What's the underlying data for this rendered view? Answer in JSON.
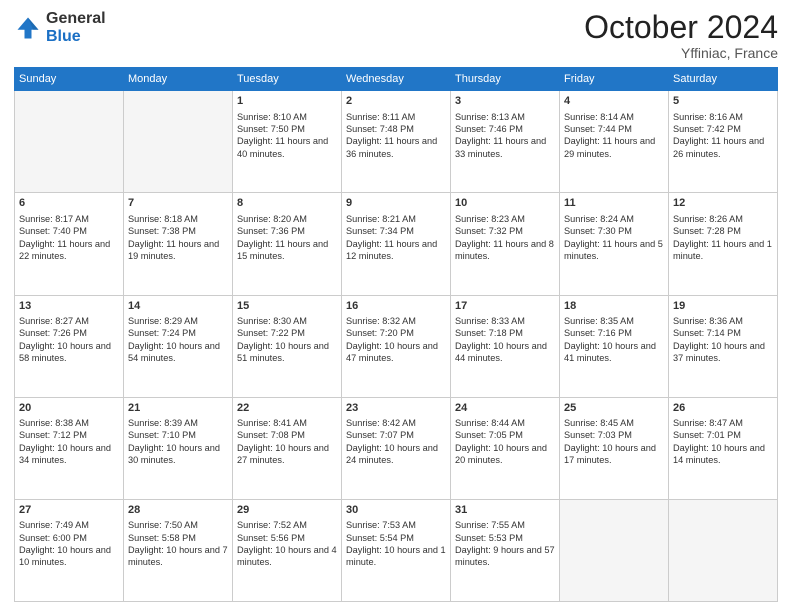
{
  "logo": {
    "general": "General",
    "blue": "Blue"
  },
  "header": {
    "month": "October 2024",
    "location": "Yffiniac, France"
  },
  "weekdays": [
    "Sunday",
    "Monday",
    "Tuesday",
    "Wednesday",
    "Thursday",
    "Friday",
    "Saturday"
  ],
  "weeks": [
    [
      {
        "day": "",
        "sunrise": "",
        "sunset": "",
        "daylight": "",
        "empty": true
      },
      {
        "day": "",
        "sunrise": "",
        "sunset": "",
        "daylight": "",
        "empty": true
      },
      {
        "day": "1",
        "sunrise": "Sunrise: 8:10 AM",
        "sunset": "Sunset: 7:50 PM",
        "daylight": "Daylight: 11 hours and 40 minutes."
      },
      {
        "day": "2",
        "sunrise": "Sunrise: 8:11 AM",
        "sunset": "Sunset: 7:48 PM",
        "daylight": "Daylight: 11 hours and 36 minutes."
      },
      {
        "day": "3",
        "sunrise": "Sunrise: 8:13 AM",
        "sunset": "Sunset: 7:46 PM",
        "daylight": "Daylight: 11 hours and 33 minutes."
      },
      {
        "day": "4",
        "sunrise": "Sunrise: 8:14 AM",
        "sunset": "Sunset: 7:44 PM",
        "daylight": "Daylight: 11 hours and 29 minutes."
      },
      {
        "day": "5",
        "sunrise": "Sunrise: 8:16 AM",
        "sunset": "Sunset: 7:42 PM",
        "daylight": "Daylight: 11 hours and 26 minutes."
      }
    ],
    [
      {
        "day": "6",
        "sunrise": "Sunrise: 8:17 AM",
        "sunset": "Sunset: 7:40 PM",
        "daylight": "Daylight: 11 hours and 22 minutes."
      },
      {
        "day": "7",
        "sunrise": "Sunrise: 8:18 AM",
        "sunset": "Sunset: 7:38 PM",
        "daylight": "Daylight: 11 hours and 19 minutes."
      },
      {
        "day": "8",
        "sunrise": "Sunrise: 8:20 AM",
        "sunset": "Sunset: 7:36 PM",
        "daylight": "Daylight: 11 hours and 15 minutes."
      },
      {
        "day": "9",
        "sunrise": "Sunrise: 8:21 AM",
        "sunset": "Sunset: 7:34 PM",
        "daylight": "Daylight: 11 hours and 12 minutes."
      },
      {
        "day": "10",
        "sunrise": "Sunrise: 8:23 AM",
        "sunset": "Sunset: 7:32 PM",
        "daylight": "Daylight: 11 hours and 8 minutes."
      },
      {
        "day": "11",
        "sunrise": "Sunrise: 8:24 AM",
        "sunset": "Sunset: 7:30 PM",
        "daylight": "Daylight: 11 hours and 5 minutes."
      },
      {
        "day": "12",
        "sunrise": "Sunrise: 8:26 AM",
        "sunset": "Sunset: 7:28 PM",
        "daylight": "Daylight: 11 hours and 1 minute."
      }
    ],
    [
      {
        "day": "13",
        "sunrise": "Sunrise: 8:27 AM",
        "sunset": "Sunset: 7:26 PM",
        "daylight": "Daylight: 10 hours and 58 minutes."
      },
      {
        "day": "14",
        "sunrise": "Sunrise: 8:29 AM",
        "sunset": "Sunset: 7:24 PM",
        "daylight": "Daylight: 10 hours and 54 minutes."
      },
      {
        "day": "15",
        "sunrise": "Sunrise: 8:30 AM",
        "sunset": "Sunset: 7:22 PM",
        "daylight": "Daylight: 10 hours and 51 minutes."
      },
      {
        "day": "16",
        "sunrise": "Sunrise: 8:32 AM",
        "sunset": "Sunset: 7:20 PM",
        "daylight": "Daylight: 10 hours and 47 minutes."
      },
      {
        "day": "17",
        "sunrise": "Sunrise: 8:33 AM",
        "sunset": "Sunset: 7:18 PM",
        "daylight": "Daylight: 10 hours and 44 minutes."
      },
      {
        "day": "18",
        "sunrise": "Sunrise: 8:35 AM",
        "sunset": "Sunset: 7:16 PM",
        "daylight": "Daylight: 10 hours and 41 minutes."
      },
      {
        "day": "19",
        "sunrise": "Sunrise: 8:36 AM",
        "sunset": "Sunset: 7:14 PM",
        "daylight": "Daylight: 10 hours and 37 minutes."
      }
    ],
    [
      {
        "day": "20",
        "sunrise": "Sunrise: 8:38 AM",
        "sunset": "Sunset: 7:12 PM",
        "daylight": "Daylight: 10 hours and 34 minutes."
      },
      {
        "day": "21",
        "sunrise": "Sunrise: 8:39 AM",
        "sunset": "Sunset: 7:10 PM",
        "daylight": "Daylight: 10 hours and 30 minutes."
      },
      {
        "day": "22",
        "sunrise": "Sunrise: 8:41 AM",
        "sunset": "Sunset: 7:08 PM",
        "daylight": "Daylight: 10 hours and 27 minutes."
      },
      {
        "day": "23",
        "sunrise": "Sunrise: 8:42 AM",
        "sunset": "Sunset: 7:07 PM",
        "daylight": "Daylight: 10 hours and 24 minutes."
      },
      {
        "day": "24",
        "sunrise": "Sunrise: 8:44 AM",
        "sunset": "Sunset: 7:05 PM",
        "daylight": "Daylight: 10 hours and 20 minutes."
      },
      {
        "day": "25",
        "sunrise": "Sunrise: 8:45 AM",
        "sunset": "Sunset: 7:03 PM",
        "daylight": "Daylight: 10 hours and 17 minutes."
      },
      {
        "day": "26",
        "sunrise": "Sunrise: 8:47 AM",
        "sunset": "Sunset: 7:01 PM",
        "daylight": "Daylight: 10 hours and 14 minutes."
      }
    ],
    [
      {
        "day": "27",
        "sunrise": "Sunrise: 7:49 AM",
        "sunset": "Sunset: 6:00 PM",
        "daylight": "Daylight: 10 hours and 10 minutes."
      },
      {
        "day": "28",
        "sunrise": "Sunrise: 7:50 AM",
        "sunset": "Sunset: 5:58 PM",
        "daylight": "Daylight: 10 hours and 7 minutes."
      },
      {
        "day": "29",
        "sunrise": "Sunrise: 7:52 AM",
        "sunset": "Sunset: 5:56 PM",
        "daylight": "Daylight: 10 hours and 4 minutes."
      },
      {
        "day": "30",
        "sunrise": "Sunrise: 7:53 AM",
        "sunset": "Sunset: 5:54 PM",
        "daylight": "Daylight: 10 hours and 1 minute."
      },
      {
        "day": "31",
        "sunrise": "Sunrise: 7:55 AM",
        "sunset": "Sunset: 5:53 PM",
        "daylight": "Daylight: 9 hours and 57 minutes."
      },
      {
        "day": "",
        "sunrise": "",
        "sunset": "",
        "daylight": "",
        "empty": true
      },
      {
        "day": "",
        "sunrise": "",
        "sunset": "",
        "daylight": "",
        "empty": true
      }
    ]
  ]
}
